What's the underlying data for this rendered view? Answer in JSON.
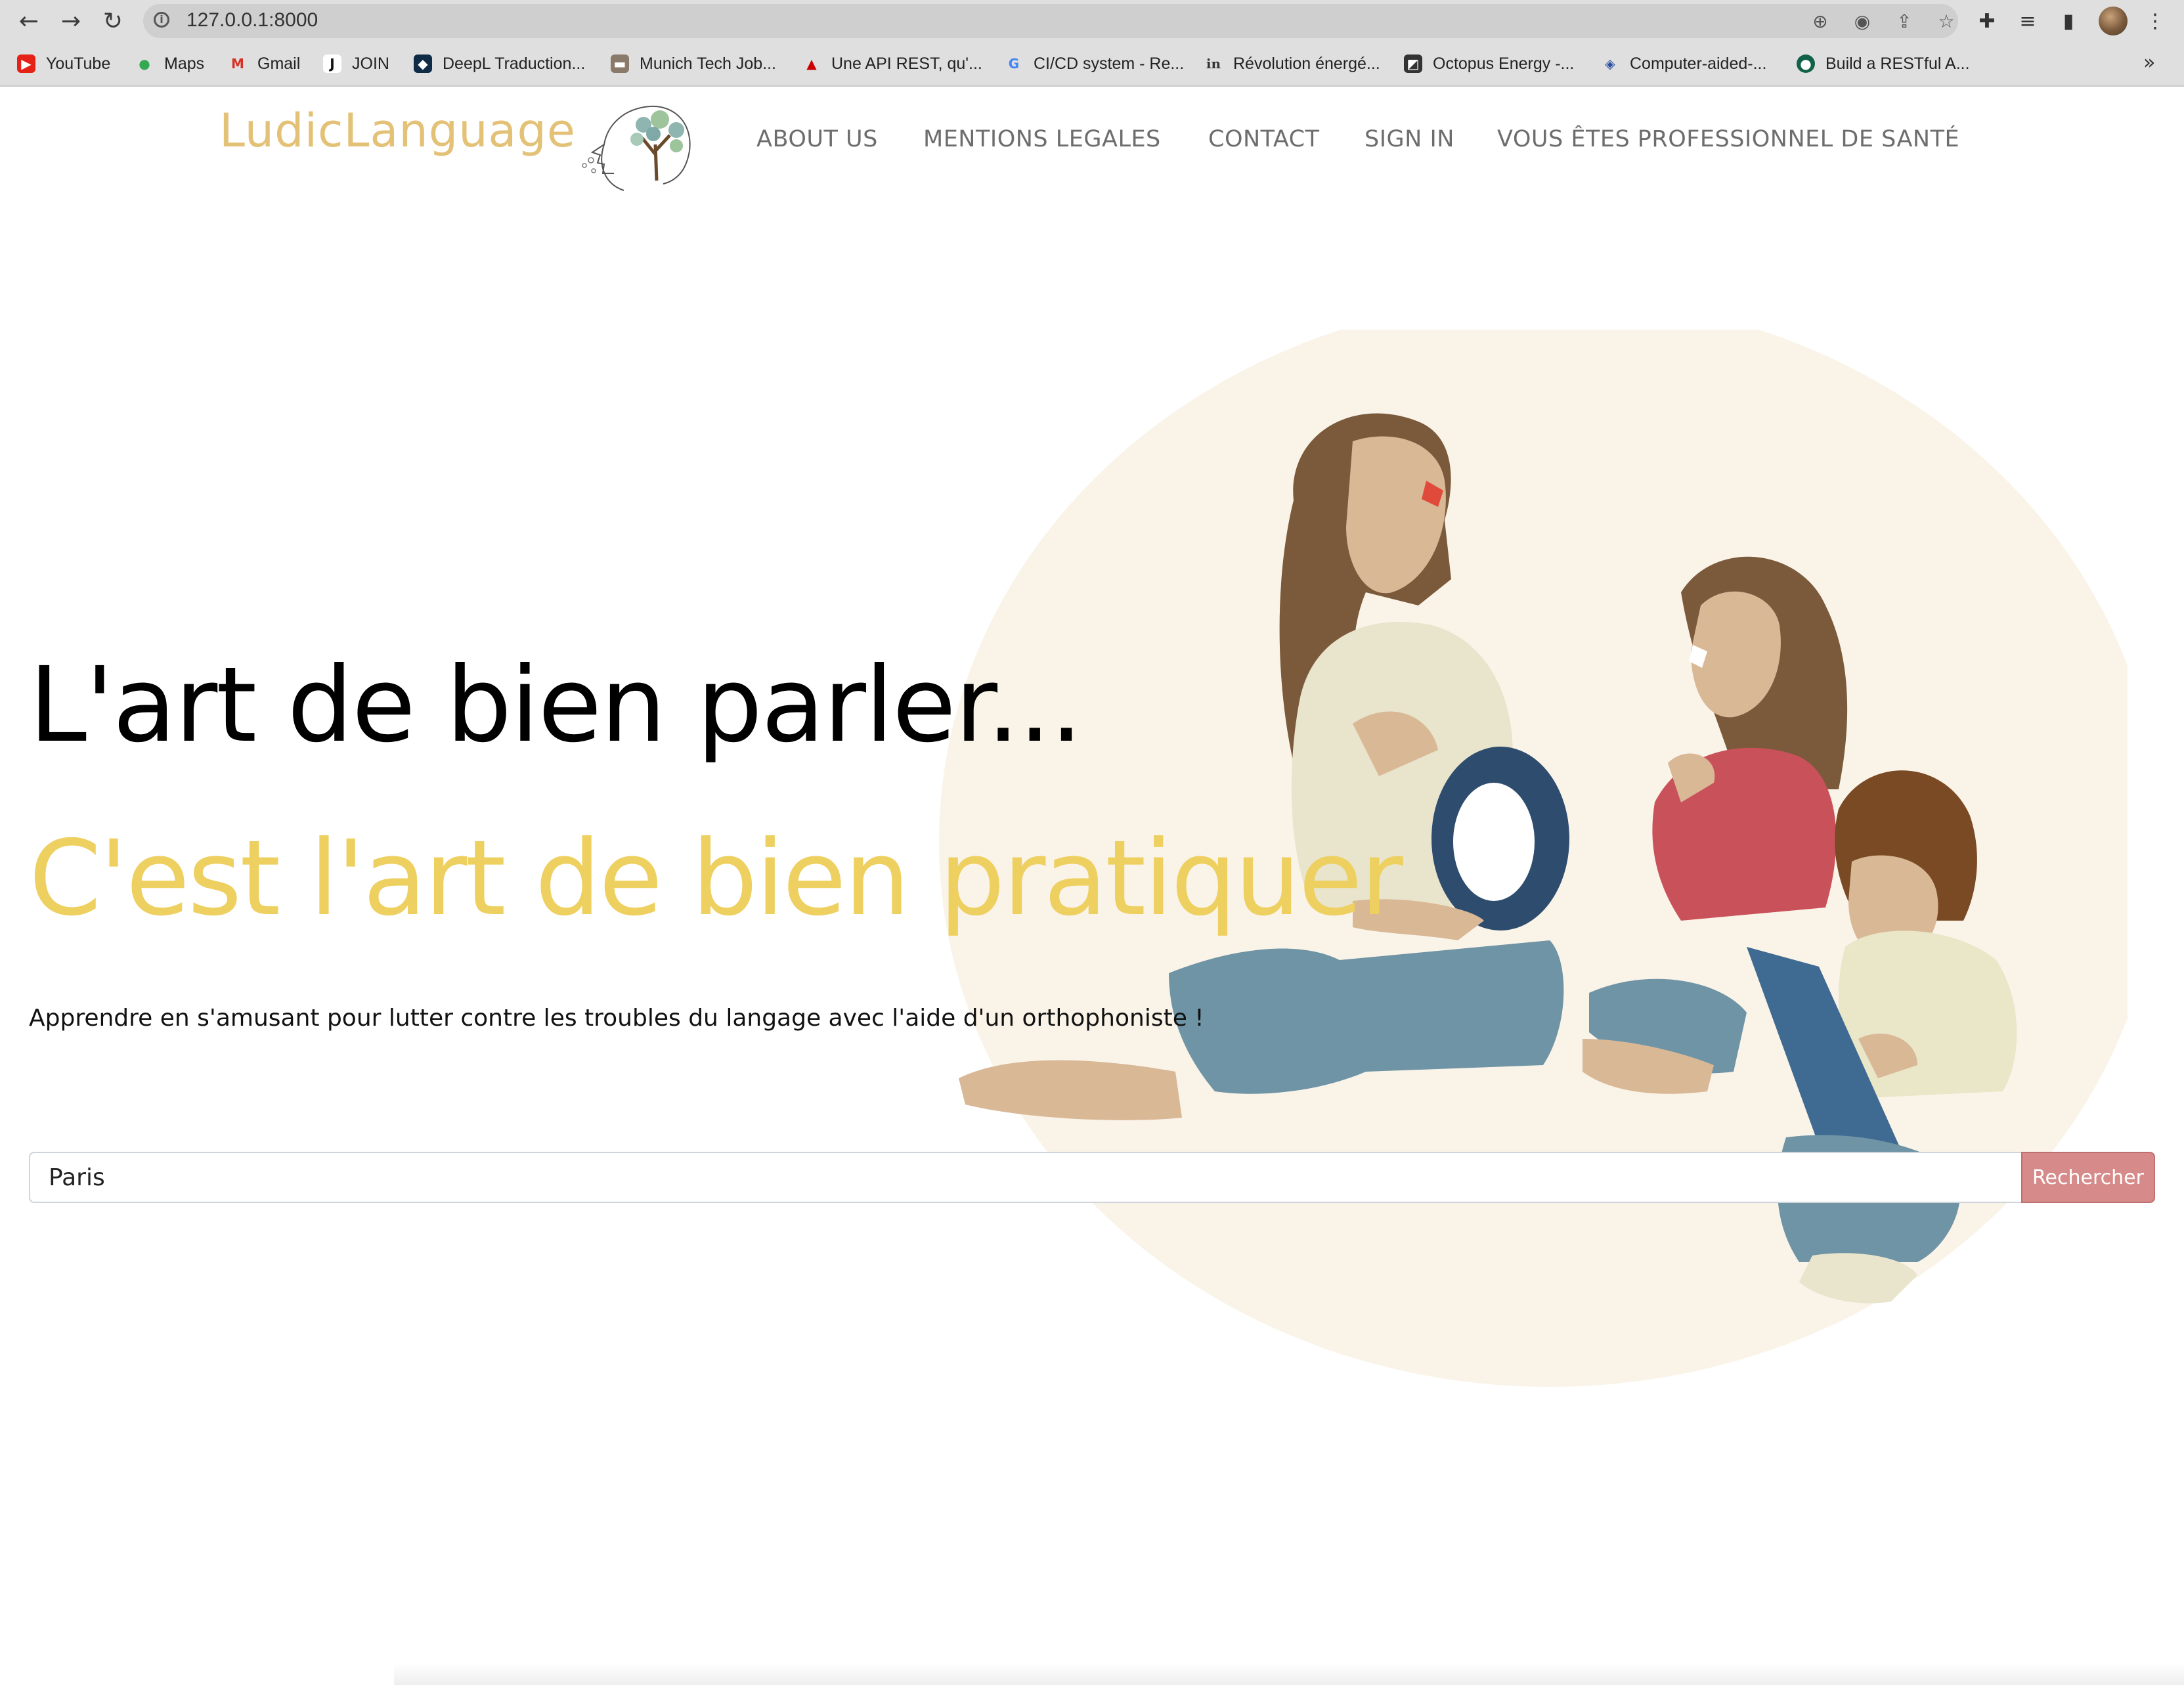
{
  "browser": {
    "url": "127.0.0.1:8000",
    "bookmarks": [
      {
        "label": "YouTube",
        "icon": "youtube-icon",
        "color": "#e62117"
      },
      {
        "label": "Maps",
        "icon": "maps-icon",
        "color": "#34a853"
      },
      {
        "label": "Gmail",
        "icon": "gmail-icon",
        "color": "#d93025"
      },
      {
        "label": "JOIN",
        "icon": "join-icon",
        "color": "#111111"
      },
      {
        "label": "DeepL Traduction...",
        "icon": "deepl-icon",
        "color": "#0f2b46"
      },
      {
        "label": "Munich Tech Job...",
        "icon": "munich-tech-icon",
        "color": "#8a7a6a"
      },
      {
        "label": "Une API REST, qu'...",
        "icon": "redhat-icon",
        "color": "#cc0000"
      },
      {
        "label": "CI/CD system - Re...",
        "icon": "google-icon",
        "color": "#4285f4"
      },
      {
        "label": "Révolution énergé...",
        "icon": "in-icon",
        "color": "#333333"
      },
      {
        "label": "Octopus Energy -...",
        "icon": "octopus-icon",
        "color": "#333333"
      },
      {
        "label": "Computer-aided-...",
        "icon": "diamond-icon",
        "color": "#2b4ea2"
      },
      {
        "label": "Build a RESTful A...",
        "icon": "mongodb-icon",
        "color": "#116149"
      }
    ],
    "more": "»"
  },
  "site": {
    "logo": "LudicLanguage",
    "nav": [
      "ABOUT US",
      "MENTIONS LEGALES",
      "CONTACT",
      "SIGN IN",
      "VOUS ÊTES PROFESSIONNEL DE SANTÉ"
    ]
  },
  "hero": {
    "title": "L'art de bien parler...",
    "subtitle": "C'est l'art de bien pratiquer",
    "tagline": "Apprendre en s'amusant pour lutter contre les troubles du langage avec l'aide d'un orthophoniste !"
  },
  "search": {
    "value": "Paris",
    "button_label": "Rechercher"
  },
  "colors": {
    "logo": "#e3c277",
    "subtitle": "#eed060",
    "nav": "#6d6d6d",
    "button": "#d68a8a",
    "circle": "#faf3e8"
  }
}
